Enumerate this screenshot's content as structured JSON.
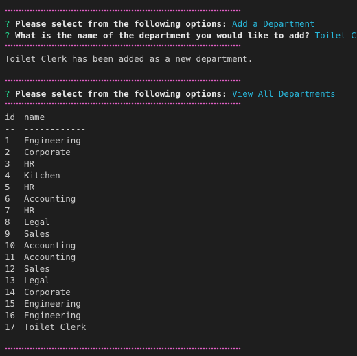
{
  "terminal": {
    "separator_char": "~",
    "prompt1": {
      "marker": "?",
      "question": "Please select from the following options:",
      "answer": "Add a Department"
    },
    "prompt2": {
      "marker": "?",
      "question": "What is the name of the department you would like to add?",
      "answer": "Toilet Clerk"
    },
    "confirmation": "Toilet Clerk has been added as a new department.",
    "prompt3": {
      "marker": "?",
      "question": "Please select from the following options:",
      "answer": "View All Departments"
    },
    "table": {
      "headers": [
        "id",
        "name"
      ],
      "dividers": [
        "--",
        "------------"
      ],
      "rows": [
        {
          "id": "1",
          "name": "Engineering"
        },
        {
          "id": "2",
          "name": "Corporate"
        },
        {
          "id": "3",
          "name": "HR"
        },
        {
          "id": "4",
          "name": "Kitchen"
        },
        {
          "id": "5",
          "name": "HR"
        },
        {
          "id": "6",
          "name": "Accounting"
        },
        {
          "id": "7",
          "name": "HR"
        },
        {
          "id": "8",
          "name": "Legal"
        },
        {
          "id": "9",
          "name": "Sales"
        },
        {
          "id": "10",
          "name": "Accounting"
        },
        {
          "id": "11",
          "name": "Accounting"
        },
        {
          "id": "12",
          "name": "Sales"
        },
        {
          "id": "13",
          "name": "Legal"
        },
        {
          "id": "14",
          "name": "Corporate"
        },
        {
          "id": "15",
          "name": "Engineering"
        },
        {
          "id": "16",
          "name": "Engineering"
        },
        {
          "id": "17",
          "name": "Toilet Clerk"
        }
      ]
    },
    "colors": {
      "background": "#1e1e1e",
      "question_mark": "#23d18b",
      "answer": "#29b8db",
      "separator": "#e05ec4",
      "text": "#cccccc"
    }
  }
}
